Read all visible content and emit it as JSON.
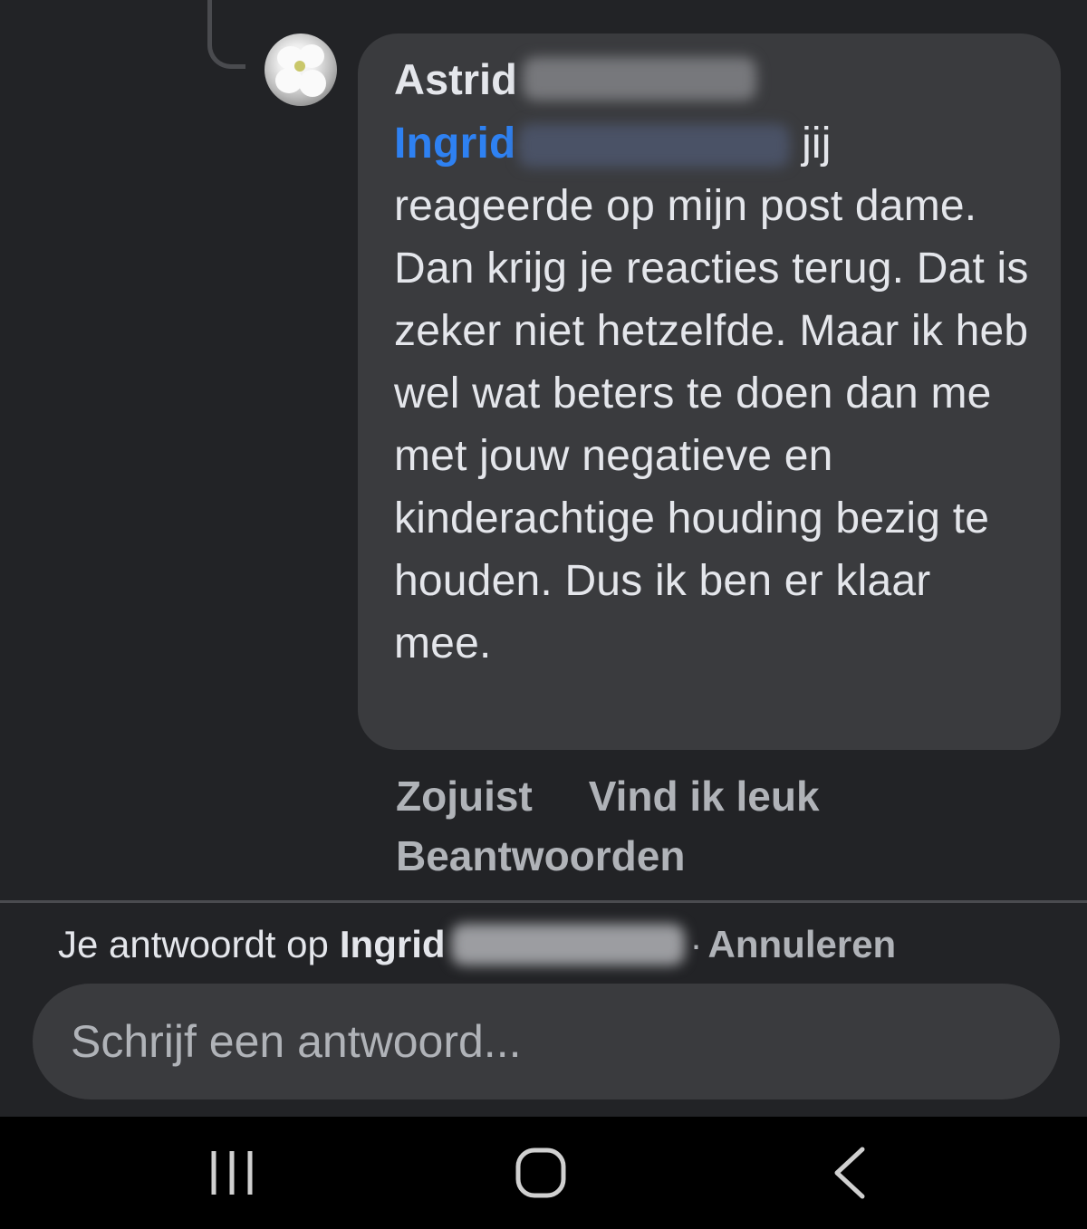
{
  "comment": {
    "author": "Astrid",
    "mention": "Ingrid",
    "text_after_mention": "jij reageerde op mijn post dame. Dan krijg je reacties terug. Dat is zeker niet hetzelfde. Maar ik heb wel wat beters te doen dan me met jouw negatieve en kinderachtige houding bezig te houden. Dus ik ben er klaar mee.",
    "timestamp": "Zojuist",
    "like_label": "Vind ik leuk",
    "reply_label": "Beantwoorden"
  },
  "reply_bar": {
    "prefix": "Je antwoordt op",
    "name": "Ingrid",
    "separator": "·",
    "cancel_label": "Annuleren"
  },
  "composer": {
    "placeholder": "Schrijf een antwoord..."
  },
  "nav": {
    "recents_icon": "recents-icon",
    "home_icon": "home-icon",
    "back_icon": "back-icon"
  },
  "colors": {
    "background": "#222326",
    "bubble": "#3a3b3e",
    "mention": "#2e81f2",
    "secondary_text": "#b0b3b8",
    "nav_bar": "#000000"
  }
}
